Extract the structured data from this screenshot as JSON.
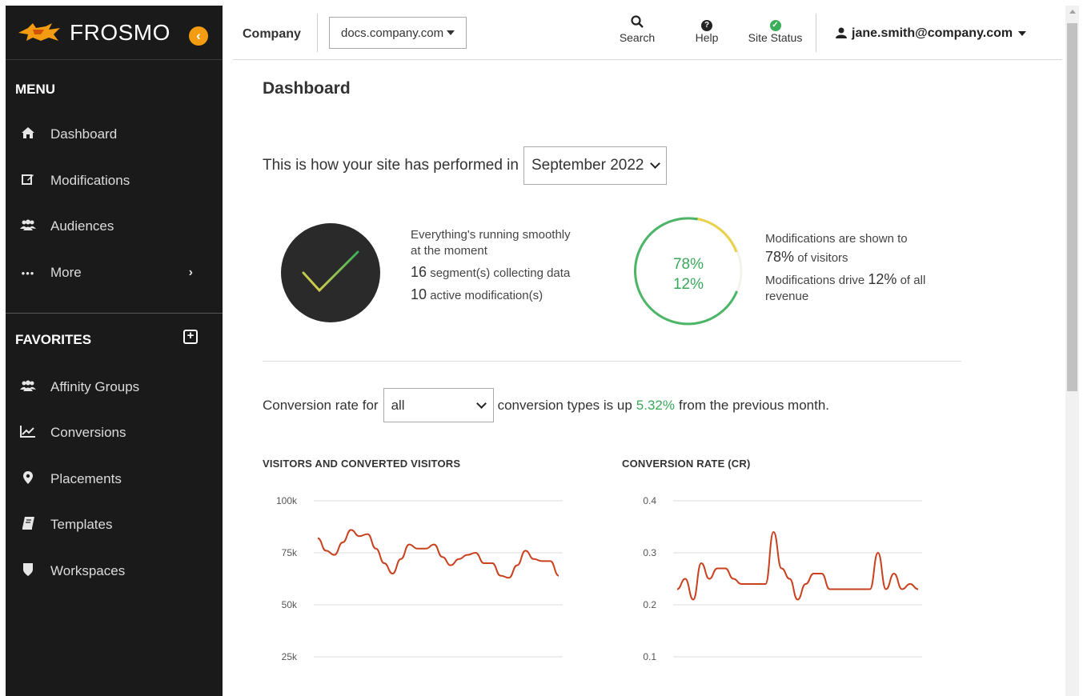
{
  "brand": {
    "name": "FROSMO",
    "accent": "#f39c12"
  },
  "sidebar": {
    "menu_title": "MENU",
    "items": [
      {
        "label": "Dashboard",
        "icon": "home-icon"
      },
      {
        "label": "Modifications",
        "icon": "edit-icon"
      },
      {
        "label": "Audiences",
        "icon": "users-icon"
      },
      {
        "label": "More",
        "icon": "ellipsis-icon"
      }
    ],
    "favorites_title": "FAVORITES",
    "favorites": [
      {
        "label": "Affinity Groups",
        "icon": "users-icon"
      },
      {
        "label": "Conversions",
        "icon": "line-chart-icon"
      },
      {
        "label": "Placements",
        "icon": "map-marker-icon"
      },
      {
        "label": "Templates",
        "icon": "book-icon"
      },
      {
        "label": "Workspaces",
        "icon": "shield-icon"
      }
    ]
  },
  "topbar": {
    "company_label": "Company",
    "site": "docs.company.com",
    "search_label": "Search",
    "help_label": "Help",
    "status_label": "Site Status",
    "user": "jane.smith@company.com"
  },
  "main": {
    "title": "Dashboard",
    "perf_prefix": "This is how your site has performed in",
    "month": "September 2022",
    "status": {
      "line1": "Everything's running smoothly",
      "line2": "at the moment",
      "segments_count": "16",
      "segments_text": "segment(s) collecting data",
      "mods_count": "10",
      "mods_text": "active modification(s)"
    },
    "ring": {
      "shown_pct": "78%",
      "revenue_pct": "12%"
    },
    "mods": {
      "line1": "Modifications are shown to",
      "shown_pct": "78%",
      "line2": "of visitors",
      "drive_prefix": "Modifications drive",
      "revenue_pct": "12%",
      "drive_suffix": "of all",
      "line4": "revenue"
    },
    "conversion": {
      "prefix": "Conversion rate for",
      "type": "all",
      "middle": "conversion types is up",
      "change": "5.32%",
      "suffix": "from the previous month."
    }
  },
  "chart_data": [
    {
      "type": "line",
      "title": "VISITORS AND CONVERTED VISITORS",
      "ylim": [
        25000,
        100000
      ],
      "yticks": [
        "100k",
        "75k",
        "50k",
        "25k"
      ],
      "ytick_values": [
        100000,
        75000,
        50000,
        25000
      ],
      "color": "#c9411e",
      "values": [
        82000,
        76000,
        74000,
        80000,
        86000,
        83000,
        84000,
        77000,
        70000,
        65000,
        72000,
        79000,
        77000,
        77000,
        79000,
        73000,
        69000,
        72000,
        74000,
        75000,
        70000,
        70000,
        64000,
        63000,
        69000,
        76000,
        72000,
        71000,
        71000,
        64000
      ]
    },
    {
      "type": "line",
      "title": "CONVERSION RATE (CR)",
      "ylim": [
        0.1,
        0.4
      ],
      "yticks": [
        "0.4",
        "0.3",
        "0.2",
        "0.1"
      ],
      "ytick_values": [
        0.4,
        0.3,
        0.2,
        0.1
      ],
      "color": "#c9411e",
      "values": [
        0.23,
        0.25,
        0.21,
        0.28,
        0.25,
        0.27,
        0.27,
        0.25,
        0.24,
        0.24,
        0.24,
        0.24,
        0.34,
        0.27,
        0.25,
        0.21,
        0.24,
        0.26,
        0.26,
        0.23,
        0.23,
        0.23,
        0.23,
        0.23,
        0.23,
        0.3,
        0.23,
        0.26,
        0.23,
        0.24,
        0.23
      ]
    }
  ]
}
